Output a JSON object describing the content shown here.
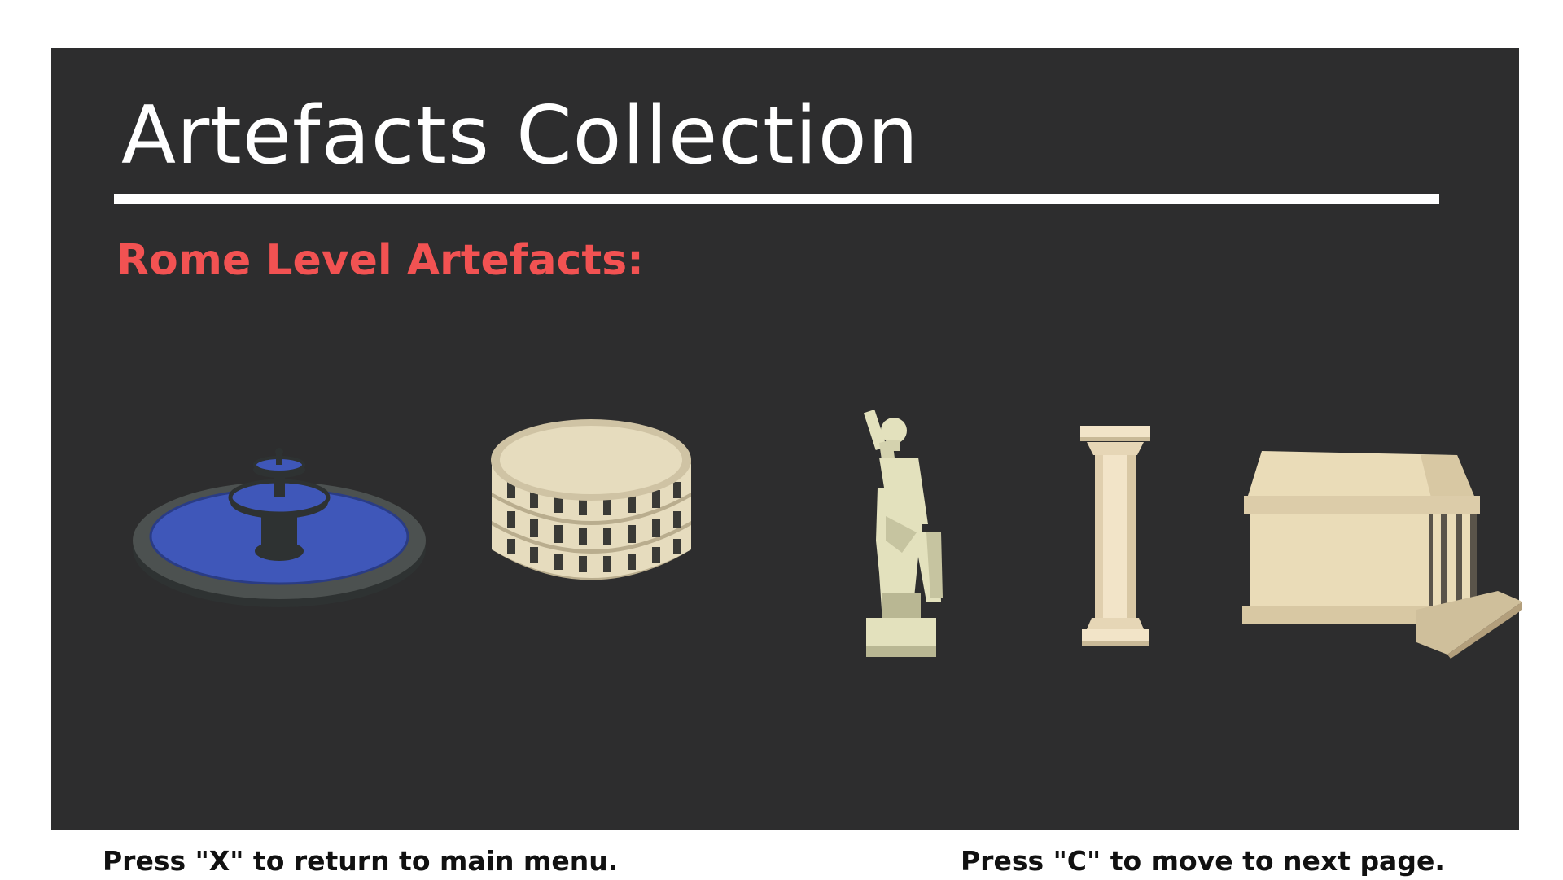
{
  "screen": {
    "title": "Artefacts Collection",
    "subtitle": "Rome Level Artefacts:"
  },
  "artefacts": [
    {
      "name": "fountain",
      "icon": "fountain-icon",
      "colors": {
        "water": "#3f57b9",
        "stone": "#4c5150",
        "dark": "#2e3232"
      }
    },
    {
      "name": "colosseum",
      "icon": "colosseum-icon",
      "colors": {
        "main": "#e6dcbe",
        "shade": "#b9ad8e"
      }
    },
    {
      "name": "statue",
      "icon": "statue-icon",
      "colors": {
        "main": "#e3e1bd",
        "shade": "#b9b793"
      }
    },
    {
      "name": "column",
      "icon": "column-icon",
      "colors": {
        "main": "#f2e4c8",
        "shade": "#c9b997"
      }
    },
    {
      "name": "temple",
      "icon": "temple-icon",
      "colors": {
        "main": "#eadcb8",
        "shade": "#bca986"
      }
    }
  ],
  "footer": {
    "back_hint": "Press \"X\" to return to main menu.",
    "next_hint": "Press \"C\" to move to next page."
  },
  "colors": {
    "panel": "#2d2d2e",
    "title": "#ffffff",
    "subtitle": "#f25252",
    "footer_text": "#111111"
  }
}
